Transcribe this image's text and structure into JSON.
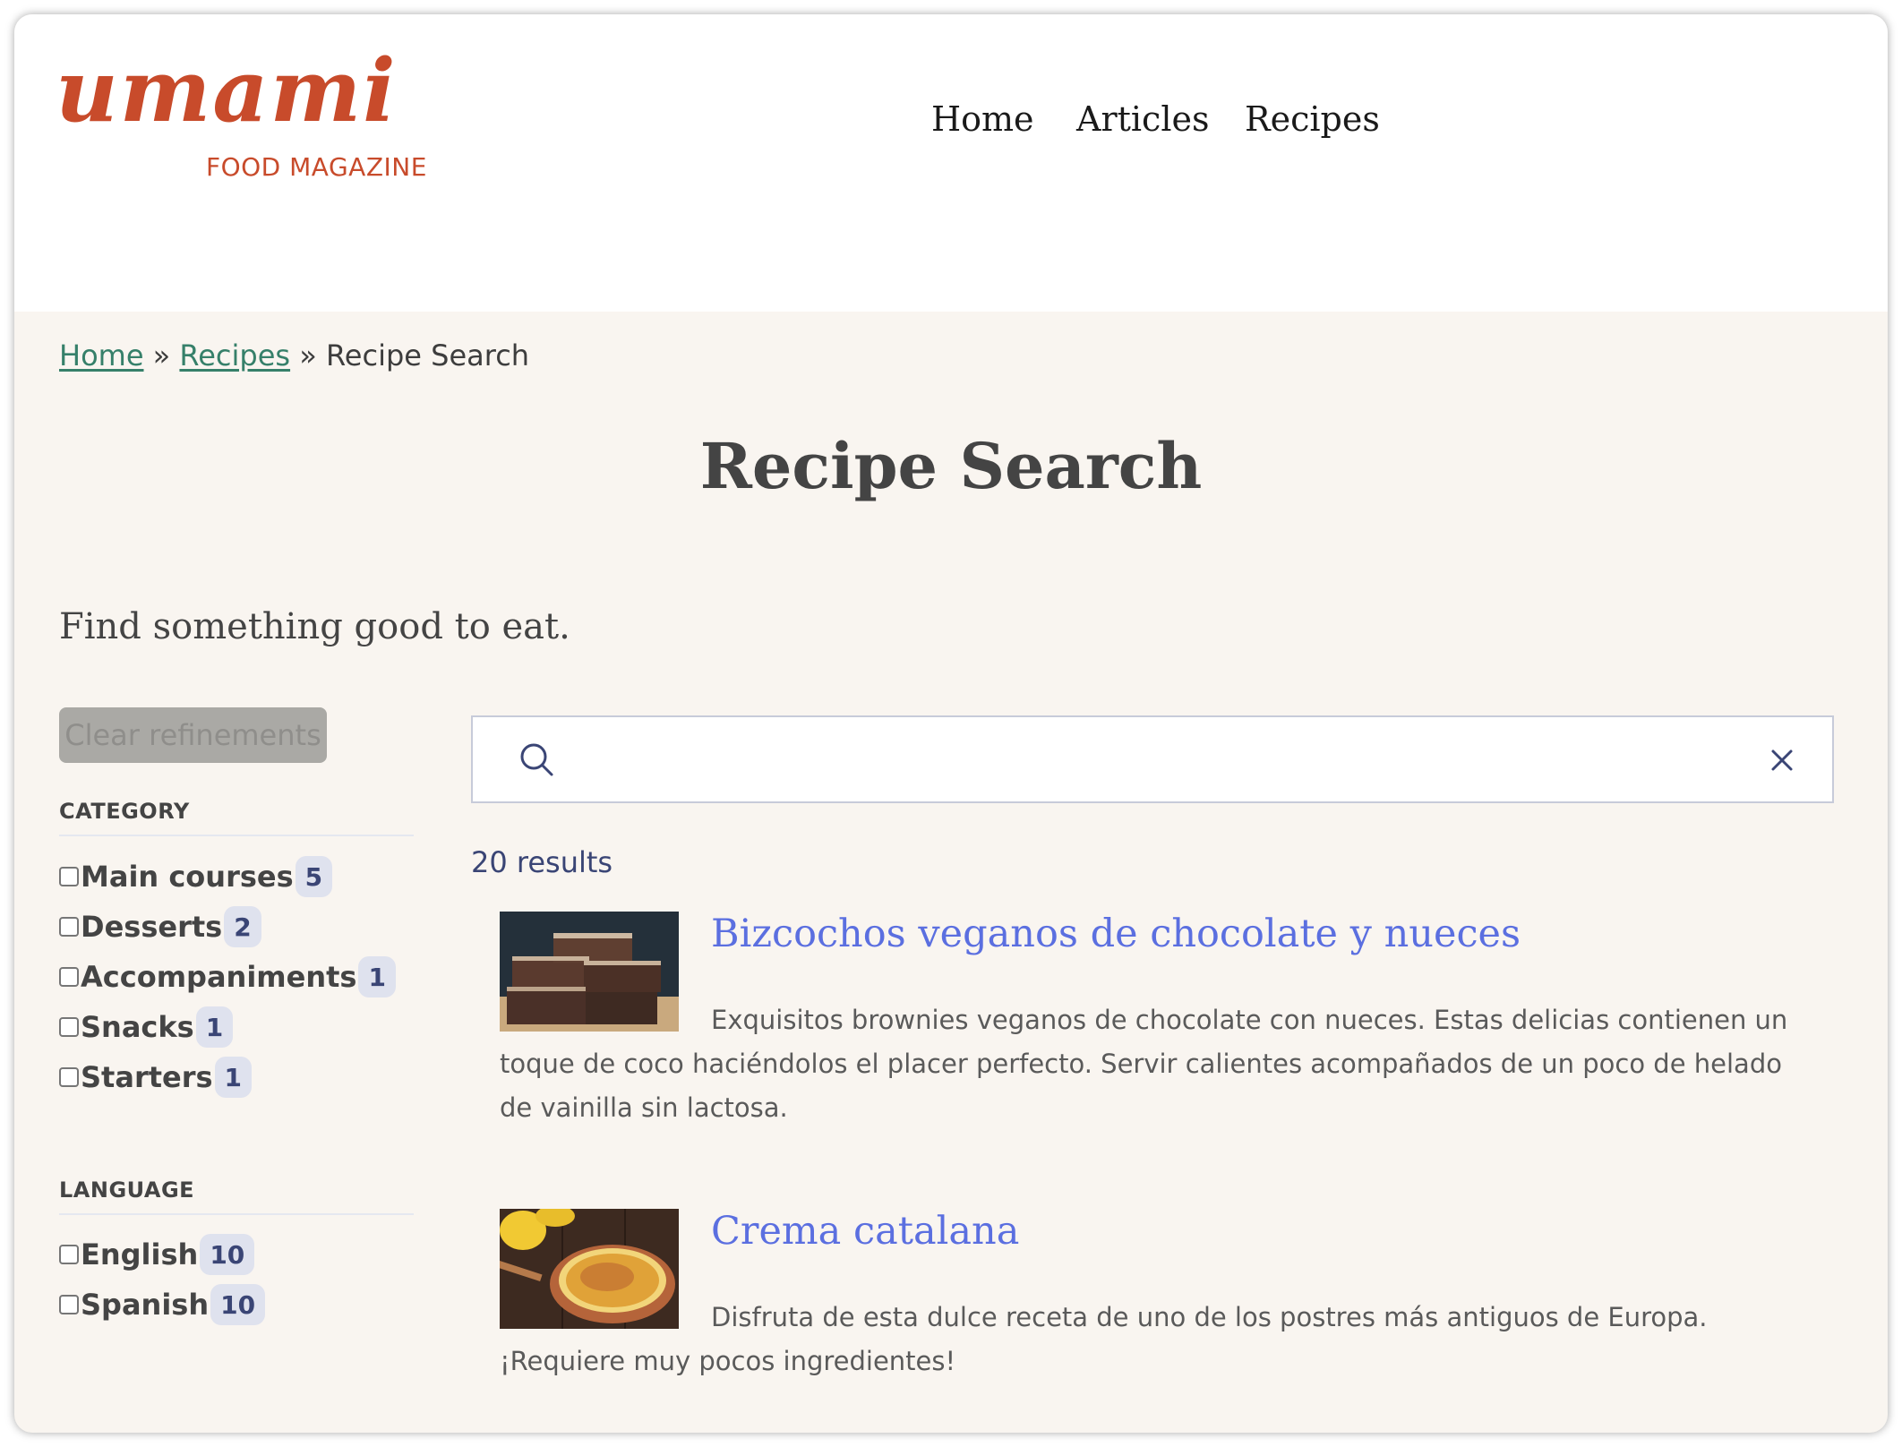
{
  "brand": {
    "logo_script": "umami",
    "logo_sub": "FOOD MAGAZINE",
    "color": "#c84b2b"
  },
  "nav": {
    "items": [
      {
        "label": "Home"
      },
      {
        "label": "Articles"
      },
      {
        "label": "Recipes"
      }
    ]
  },
  "breadcrumb": {
    "items": [
      {
        "label": "Home",
        "link": true
      },
      {
        "label": "Recipes",
        "link": true
      },
      {
        "label": "Recipe Search",
        "link": false
      }
    ],
    "separator": "»"
  },
  "page": {
    "title": "Recipe Search",
    "tagline": "Find something good to eat."
  },
  "refinements": {
    "clear_label": "Clear refinements",
    "facets": [
      {
        "title": "CATEGORY",
        "items": [
          {
            "label": "Main courses",
            "count": "5",
            "checked": false
          },
          {
            "label": "Desserts",
            "count": "2",
            "checked": false
          },
          {
            "label": "Accompaniments",
            "count": "1",
            "checked": false
          },
          {
            "label": "Snacks",
            "count": "1",
            "checked": false
          },
          {
            "label": "Starters",
            "count": "1",
            "checked": false
          }
        ]
      },
      {
        "title": "LANGUAGE",
        "items": [
          {
            "label": "English",
            "count": "10",
            "checked": false
          },
          {
            "label": "Spanish",
            "count": "10",
            "checked": false
          }
        ]
      }
    ]
  },
  "search": {
    "value": "",
    "placeholder": "",
    "search_icon": "search-icon",
    "clear_icon": "close-icon"
  },
  "results": {
    "count_label": "20 results",
    "items": [
      {
        "title": "Bizcochos veganos de chocolate y nueces",
        "description": "Exquisitos brownies veganos de chocolate con nueces. Estas delicias contienen un toque de coco haciéndolos el placer perfecto. Servir calientes acompañados de un poco de helado de vainilla sin lactosa.",
        "image": "brownies-photo"
      },
      {
        "title": "Crema catalana",
        "description": "Disfruta de esta dulce receta de uno de los postres más antiguos de Europa. ¡Requiere muy pocos ingredientes!",
        "image": "crema-catalana-photo"
      }
    ]
  },
  "colors": {
    "link_green": "#36806a",
    "result_title": "#5b6fe0",
    "badge_bg": "#dfe2ee",
    "badge_text": "#3a4575",
    "page_bg": "#f9f5f0"
  }
}
